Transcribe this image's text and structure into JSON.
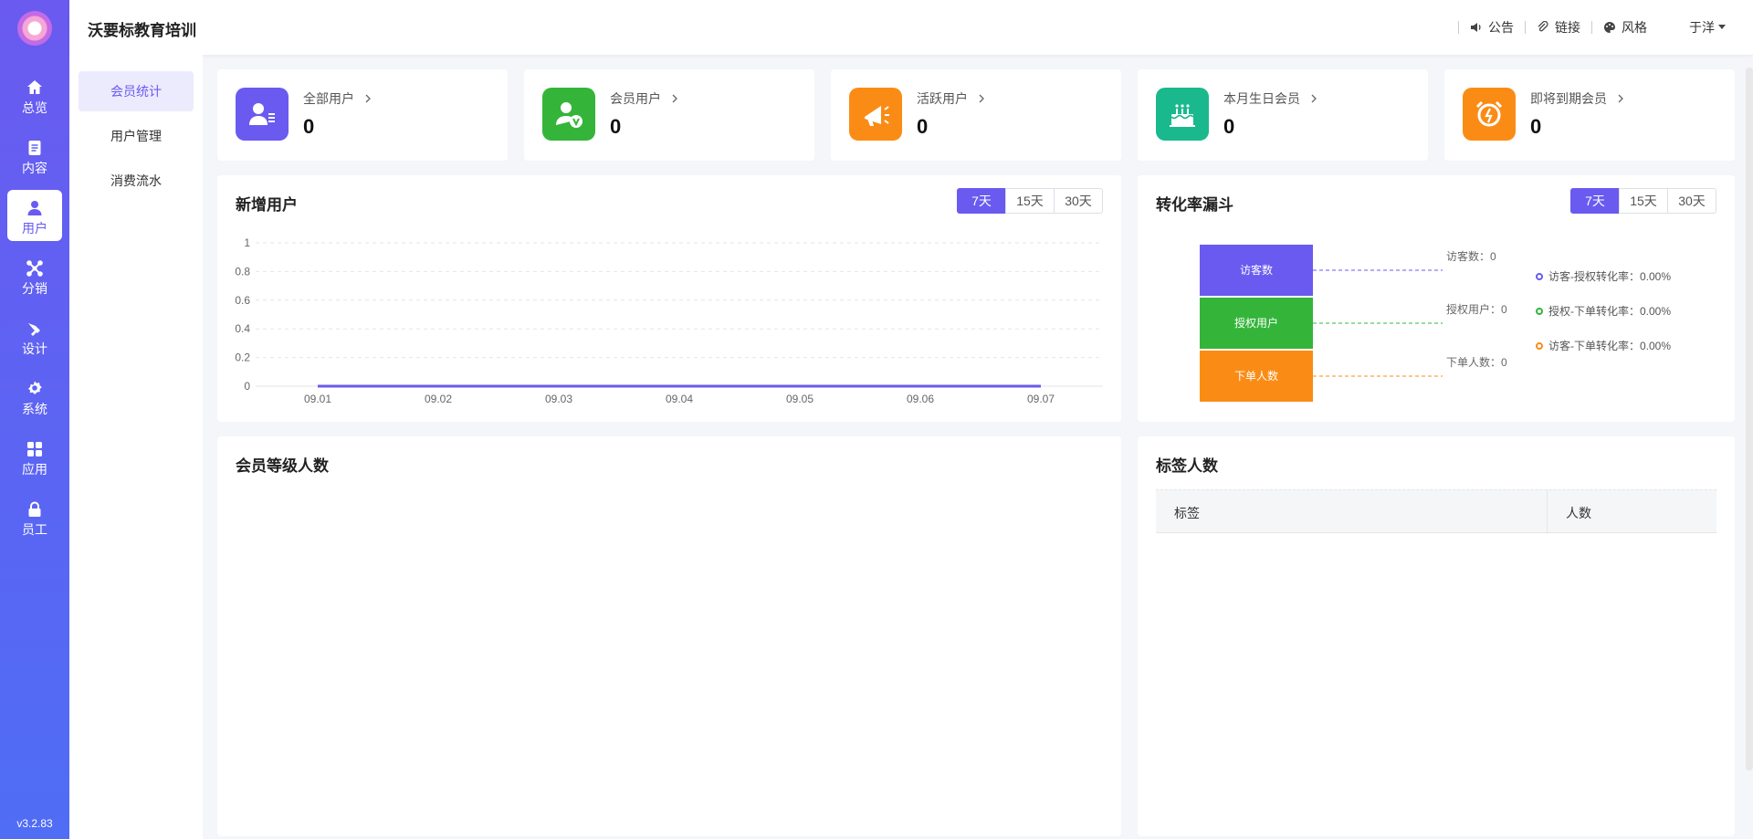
{
  "rail": {
    "items": [
      {
        "label": "总览",
        "icon": "home-icon"
      },
      {
        "label": "内容",
        "icon": "document-icon"
      },
      {
        "label": "用户",
        "icon": "user-icon"
      },
      {
        "label": "分销",
        "icon": "share-network-icon"
      },
      {
        "label": "设计",
        "icon": "brush-icon"
      },
      {
        "label": "系统",
        "icon": "gear-icon"
      },
      {
        "label": "应用",
        "icon": "apps-grid-icon"
      },
      {
        "label": "员工",
        "icon": "lock-icon"
      }
    ],
    "version": "v3.2.83"
  },
  "header": {
    "title": "沃要标教育培训",
    "notice": "公告",
    "links": "链接",
    "style": "风格",
    "user": "于洋"
  },
  "submenu": [
    "会员统计",
    "用户管理",
    "消费流水"
  ],
  "stats": [
    {
      "label": "全部用户",
      "value": "0",
      "color": "#6a5af0",
      "icon": "user-card-icon"
    },
    {
      "label": "会员用户",
      "value": "0",
      "color": "#34b53a",
      "icon": "vip-user-icon"
    },
    {
      "label": "活跃用户",
      "value": "0",
      "color": "#fa8c16",
      "icon": "megaphone-icon"
    },
    {
      "label": "本月生日会员",
      "value": "0",
      "color": "#19b98d",
      "icon": "cake-icon"
    },
    {
      "label": "即将到期会员",
      "value": "0",
      "color": "#fa8c16",
      "icon": "alarm-clock-icon"
    }
  ],
  "new_users": {
    "title": "新增用户",
    "ranges": [
      "7天",
      "15天",
      "30天"
    ]
  },
  "funnel": {
    "title": "转化率漏斗",
    "ranges": [
      "7天",
      "15天",
      "30天"
    ],
    "stages": [
      {
        "label": "访客数",
        "side": "访客数：0",
        "color": "#6a5af0"
      },
      {
        "label": "授权用户",
        "side": "授权用户：0",
        "color": "#34b53a"
      },
      {
        "label": "下单人数",
        "side": "下单人数：0",
        "color": "#fa8c16"
      }
    ],
    "legend": [
      {
        "text": "访客-授权转化率：0.00%",
        "color": "#6a5af0"
      },
      {
        "text": "授权-下单转化率：0.00%",
        "color": "#34b53a"
      },
      {
        "text": "访客-下单转化率：0.00%",
        "color": "#fa8c16"
      }
    ]
  },
  "member_level": {
    "title": "会员等级人数"
  },
  "tags": {
    "title": "标签人数",
    "col_tag": "标签",
    "col_count": "人数"
  },
  "chart_data": {
    "type": "line",
    "x": [
      "09.01",
      "09.02",
      "09.03",
      "09.04",
      "09.05",
      "09.06",
      "09.07"
    ],
    "series": [
      {
        "values": [
          0,
          0,
          0,
          0,
          0,
          0,
          0
        ],
        "color": "#6a5af0"
      }
    ],
    "yticks": [
      "1",
      "0.8",
      "0.6",
      "0.4",
      "0.2",
      "0"
    ],
    "ylim": [
      0,
      1
    ],
    "grid": true
  }
}
